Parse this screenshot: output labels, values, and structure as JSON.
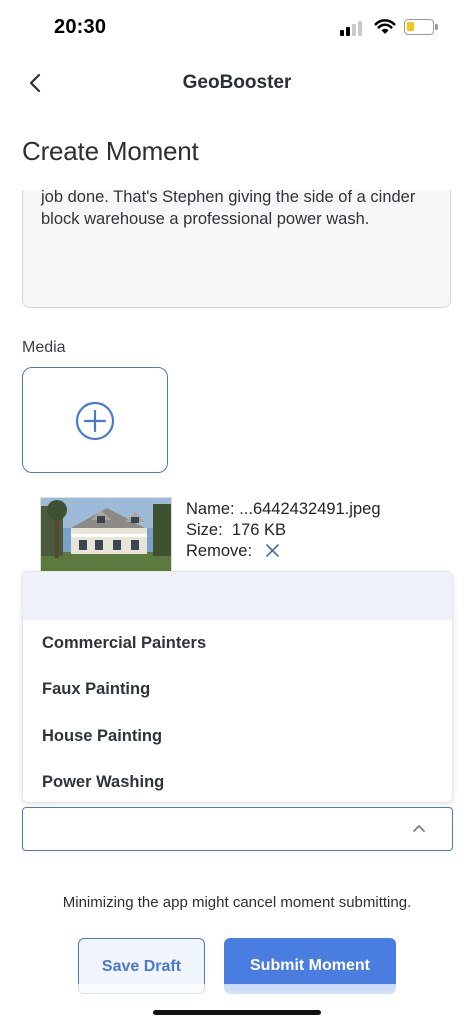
{
  "status_bar": {
    "time": "20:30"
  },
  "nav": {
    "title": "GeoBooster"
  },
  "page": {
    "title": "Create Moment"
  },
  "description": {
    "text": "job done. That's Stephen giving the side of a cinder block warehouse a professional power wash."
  },
  "media": {
    "label": "Media",
    "file": {
      "name_label": "Name:",
      "name_value": "...6442432491.jpeg",
      "size_label": "Size:",
      "size_value": "176 KB",
      "remove_label": "Remove:"
    }
  },
  "category_dropdown": {
    "options": [
      "Commercial Painters",
      "Faux Painting",
      "House Painting",
      "Power Washing"
    ],
    "selected_value": ""
  },
  "warning": "Minimizing the app might cancel moment submitting.",
  "buttons": {
    "save_draft": "Save Draft",
    "submit": "Submit Moment"
  },
  "colors": {
    "accent": "#4a7de0",
    "accent_border": "#4a78cf",
    "dropdown_highlight": "#eef1fa"
  }
}
